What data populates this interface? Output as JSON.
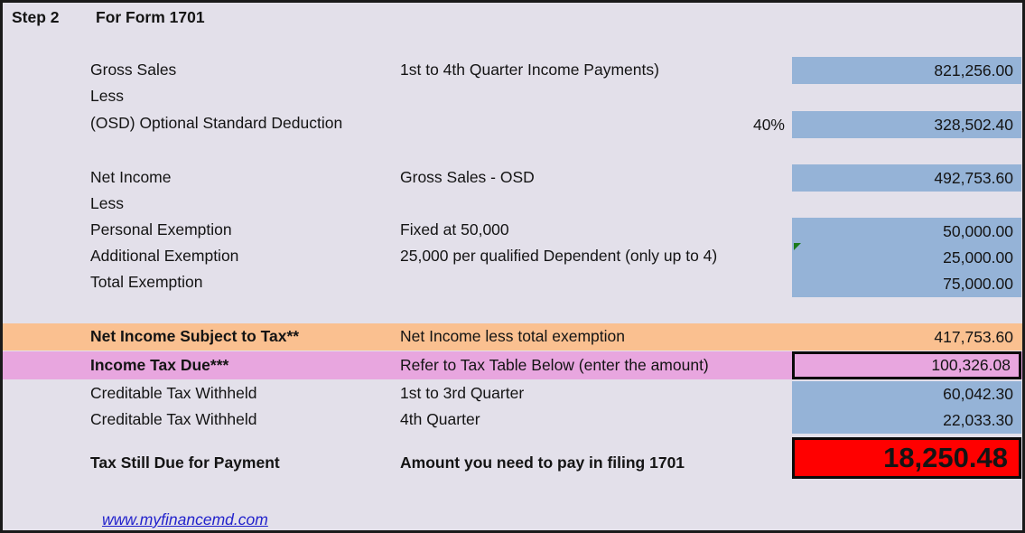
{
  "header": {
    "step_label": "Step 2",
    "form_label": "For Form 1701"
  },
  "colors": {
    "background": "#E3E0EA",
    "value_fill": "#95B3D7",
    "highlight_orange": "#FAC090",
    "highlight_pink": "#E8A6DF",
    "total_red": "#FF0000",
    "link": "#2222CC",
    "note_marker": "#1a7a1a"
  },
  "rows": {
    "gross_sales": {
      "label": "Gross Sales",
      "description": "1st to 4th Quarter Income Payments)",
      "value": "821,256.00"
    },
    "less_1": {
      "label": "Less"
    },
    "osd": {
      "label": "(OSD) Optional Standard Deduction",
      "rate": "40%",
      "value": "328,502.40"
    },
    "net_income": {
      "label": "Net Income",
      "description": "Gross Sales - OSD",
      "value": "492,753.60"
    },
    "less_2": {
      "label": "Less"
    },
    "personal_exemption": {
      "label": "Personal Exemption",
      "description": "Fixed at 50,000",
      "value": "50,000.00"
    },
    "additional_exemption": {
      "label": "Additional Exemption",
      "description": "25,000 per qualified Dependent (only up to 4)",
      "value": "25,000.00"
    },
    "total_exemption": {
      "label": "Total Exemption",
      "value": "75,000.00"
    },
    "net_income_subject_to_tax": {
      "label": "Net Income Subject to Tax**",
      "description": "Net Income less total exemption",
      "value": "417,753.60"
    },
    "income_tax_due": {
      "label": "Income Tax Due***",
      "description": "Refer to Tax Table Below (enter the amount)",
      "value": "100,326.08"
    },
    "creditable_withheld_1": {
      "label": "Creditable Tax Withheld",
      "description": "1st to 3rd Quarter",
      "value": "60,042.30"
    },
    "creditable_withheld_2": {
      "label": "Creditable Tax Withheld",
      "description": "4th Quarter",
      "value": "22,033.30"
    },
    "tax_still_due": {
      "label": "Tax Still Due for Payment",
      "description": "Amount you need to pay in filing 1701",
      "value": "18,250.48"
    }
  },
  "footer": {
    "link_text": "www.myfinancemd.com"
  }
}
